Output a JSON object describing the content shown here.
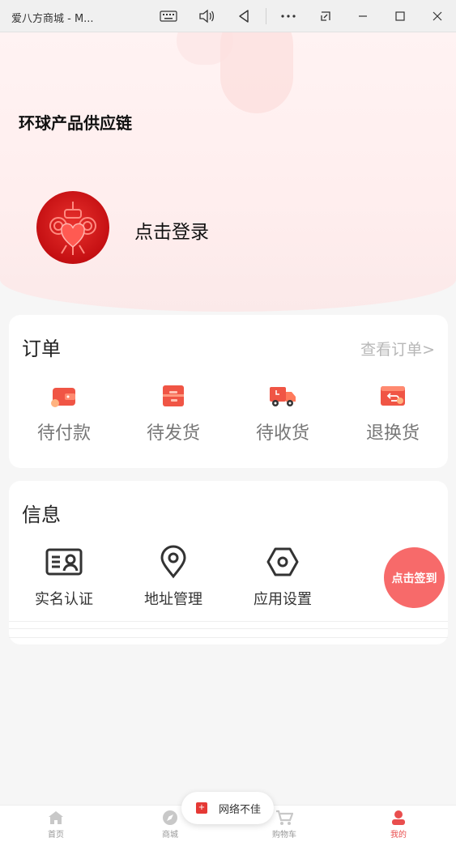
{
  "window": {
    "title": "爱八方商城 - M..."
  },
  "header": {
    "brand": "环球产品供应链",
    "login_text": "点击登录"
  },
  "orders": {
    "title": "订单",
    "view_all": "查看订单>",
    "items": [
      {
        "label": "待付款",
        "icon": "wallet-icon"
      },
      {
        "label": "待发货",
        "icon": "box-icon"
      },
      {
        "label": "待收货",
        "icon": "truck-icon"
      },
      {
        "label": "退换货",
        "icon": "return-icon"
      }
    ]
  },
  "info": {
    "title": "信息",
    "items": [
      {
        "label": "实名认证",
        "icon": "id-card-icon"
      },
      {
        "label": "地址管理",
        "icon": "location-pin-icon"
      },
      {
        "label": "应用设置",
        "icon": "settings-hex-icon"
      }
    ],
    "signin_label": "点击签到"
  },
  "toast": {
    "message": "网络不佳"
  },
  "tabbar": {
    "items": [
      {
        "label": "首页",
        "icon": "home-icon"
      },
      {
        "label": "商城",
        "icon": "compass-icon"
      },
      {
        "label": "购物车",
        "icon": "cart-icon"
      },
      {
        "label": "我的",
        "icon": "user-icon",
        "active": true
      }
    ]
  },
  "colors": {
    "accent": "#f76a6a",
    "icon_red": "#f05545",
    "tab_active": "#e94e4e"
  }
}
